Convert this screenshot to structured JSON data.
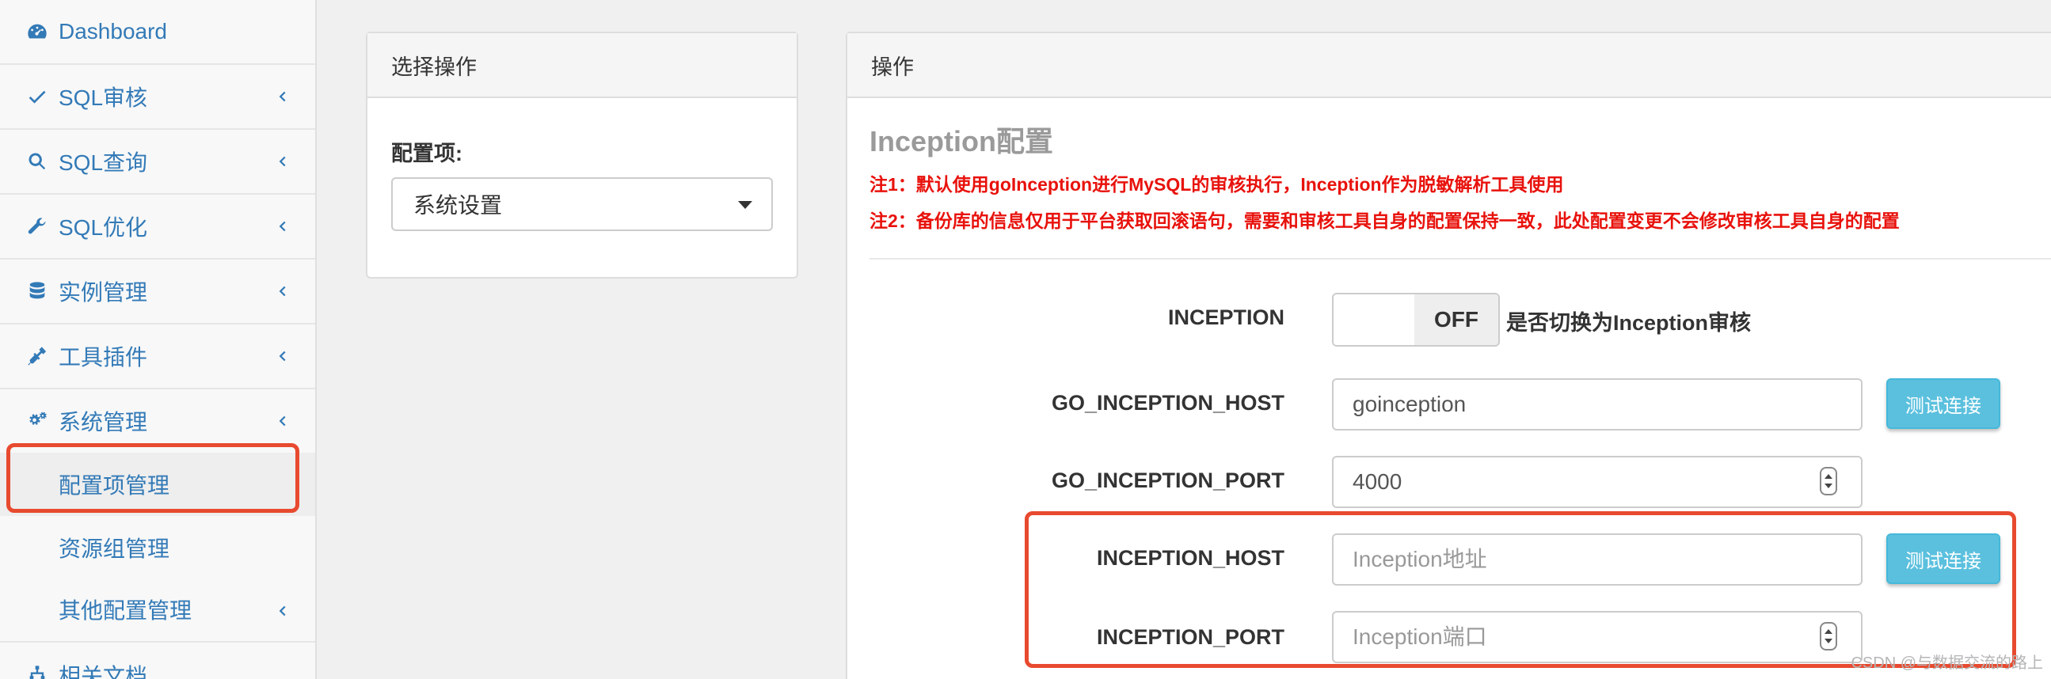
{
  "sidebar": {
    "items": [
      {
        "label": "Dashboard",
        "icon": "dashboard-icon"
      },
      {
        "label": "SQL审核",
        "icon": "check-icon"
      },
      {
        "label": "SQL查询",
        "icon": "search-icon"
      },
      {
        "label": "SQL优化",
        "icon": "wrench-icon"
      },
      {
        "label": "实例管理",
        "icon": "database-icon"
      },
      {
        "label": "工具插件",
        "icon": "plug-icon"
      },
      {
        "label": "系统管理",
        "icon": "gears-icon"
      },
      {
        "label": "相关文档",
        "icon": "sitemap-icon"
      }
    ],
    "sub_items": [
      {
        "label": "配置项管理",
        "active": true
      },
      {
        "label": "资源组管理"
      },
      {
        "label": "其他配置管理"
      }
    ]
  },
  "select_panel": {
    "heading": "选择操作",
    "field_label": "配置项:",
    "selected_value": "系统设置"
  },
  "ops_panel": {
    "heading": "操作",
    "section_title": "Inception配置",
    "notes": [
      "注1：默认使用goInception进行MySQL的审核执行，Inception作为脱敏解析工具使用",
      "注2：备份库的信息仅用于平台获取回滚语句，需要和审核工具自身的配置保持一致，此处配置变更不会修改审核工具自身的配置"
    ],
    "inception_toggle": {
      "label": "INCEPTION",
      "state": "OFF",
      "description": "是否切换为Inception审核"
    },
    "go_host": {
      "label": "GO_INCEPTION_HOST",
      "value": "goinception",
      "button": "测试连接"
    },
    "go_port": {
      "label": "GO_INCEPTION_PORT",
      "value": "4000"
    },
    "inc_host": {
      "label": "INCEPTION_HOST",
      "placeholder": "Inception地址",
      "button": "测试连接"
    },
    "inc_port": {
      "label": "INCEPTION_PORT",
      "placeholder": "Inception端口"
    }
  },
  "watermark": "CSDN @与数据交流的路上",
  "colors": {
    "link_blue": "#337ab7",
    "highlight_red": "#e84a2f",
    "note_red": "#e8120c",
    "info_button": "#5bc0de"
  }
}
